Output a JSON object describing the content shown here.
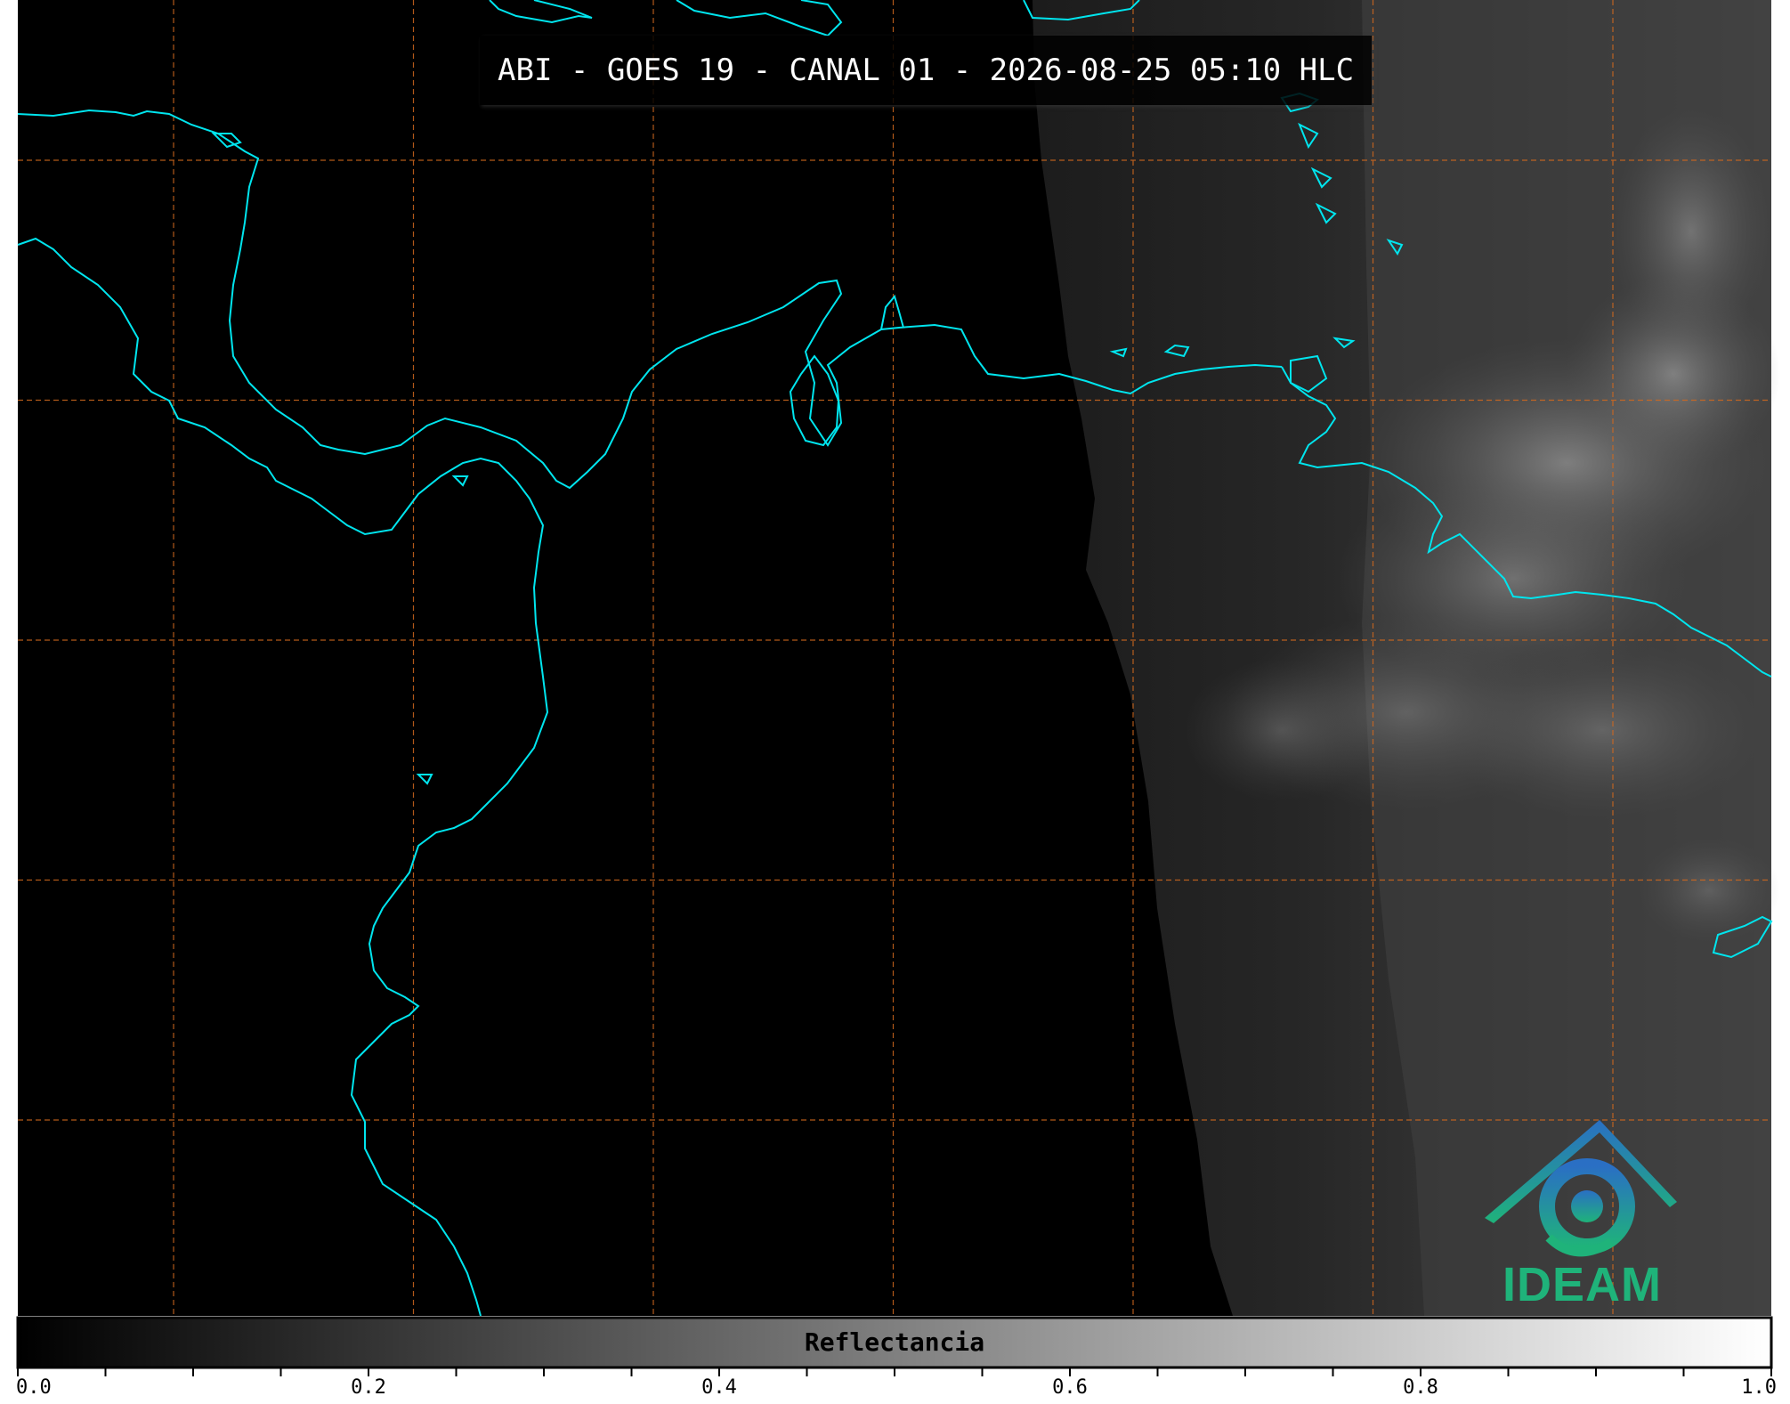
{
  "title": "ABI - GOES 19 - CANAL 01 - 2026-08-25 05:10 HLC",
  "colorbar": {
    "label": "Reflectancia",
    "ticks": [
      "0.0",
      "0.2",
      "0.4",
      "0.6",
      "0.8",
      "1.0"
    ],
    "range": [
      0.0,
      1.0
    ],
    "minor_step": 0.05
  },
  "logo": {
    "text": "IDEAM"
  },
  "colors": {
    "background": "#000000",
    "coastline": "#00e5ee",
    "gridline": "#d2691e",
    "logo_text": "#1fb37a",
    "logo_mark_top": "#2a7bc0",
    "logo_mark_bottom": "#1fb37a"
  },
  "map": {
    "gridlines": "dashed",
    "grid_columns": 7,
    "grid_rows": 5
  }
}
